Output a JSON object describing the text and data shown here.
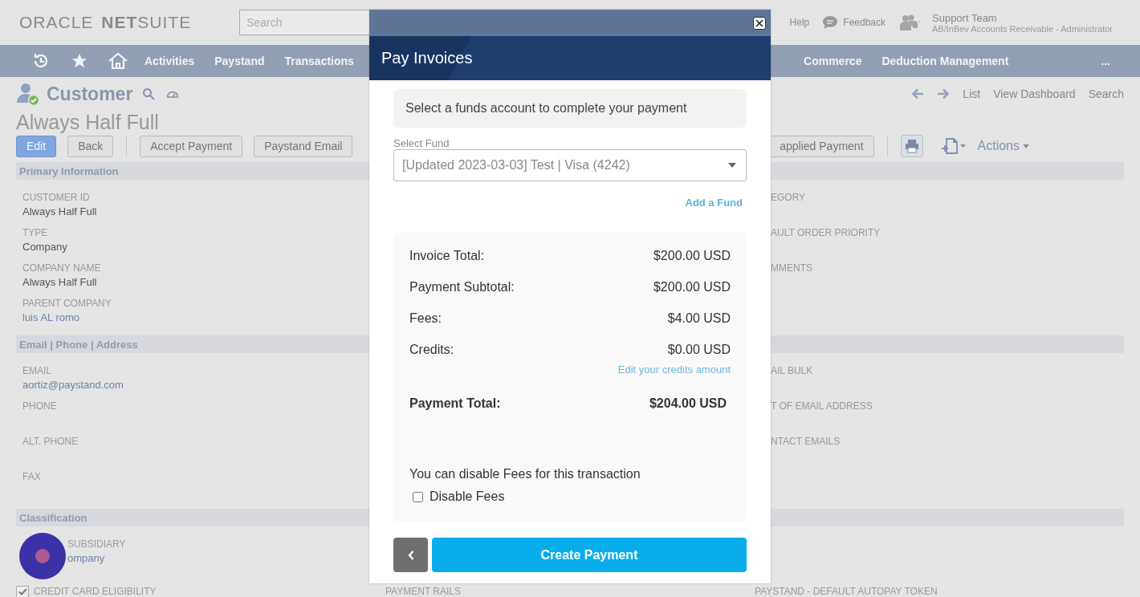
{
  "header": {
    "logo": {
      "brand": "ORACLE",
      "product": "**NET**SUITE"
    },
    "search": {
      "placeholder": "Search"
    },
    "links": [
      "Help",
      "Feedback"
    ],
    "user": {
      "name": "Support Team",
      "role": "AB/InBev Accounts Receivable - Administrator"
    }
  },
  "nav": {
    "items": [
      "Activities",
      "Paystand",
      "Transactions"
    ],
    "right_items": [
      "Commerce",
      "Deduction Management"
    ],
    "overflow": "..."
  },
  "record": {
    "type": "Customer",
    "name": "Always Half Full",
    "nav_links": [
      "List",
      "View Dashboard",
      "Search"
    ],
    "buttons": [
      {
        "label": "Edit",
        "primary": true
      },
      {
        "label": "Back",
        "primary": false
      },
      {
        "label": "Accept Payment",
        "primary": false
      },
      {
        "label": "Paystand Email",
        "primary": false
      }
    ],
    "right_buttons": [
      {
        "label": "applied Payment",
        "primary": false
      }
    ],
    "actions": "Actions"
  },
  "sections": [
    {
      "title": "Primary Information",
      "left": [
        {
          "label": "CUSTOMER ID",
          "value": "Always Half Full",
          "link": false
        },
        {
          "label": "TYPE",
          "value": "Company",
          "link": false
        },
        {
          "label": "COMPANY NAME",
          "value": "Always Half Full",
          "link": false
        },
        {
          "label": "PARENT COMPANY",
          "value": "luis AL romo",
          "link": true
        }
      ],
      "right": [
        "EGORY",
        "AULT ORDER PRIORITY",
        "MMENTS"
      ]
    },
    {
      "title": "Email | Phone | Address",
      "left": [
        {
          "label": "EMAIL",
          "value": "aortiz@paystand.com",
          "link": true
        },
        {
          "label": "PHONE"
        },
        {
          "label": "ALT. PHONE"
        },
        {
          "label": "FAX"
        }
      ],
      "right": [
        "AIL BULK",
        "T OF EMAIL ADDRESS",
        "NTACT EMAILS"
      ]
    },
    {
      "title": "Classification",
      "left": [
        {
          "label": "SUBSIDIARY",
          "value": "ompany",
          "link": true
        }
      ]
    }
  ],
  "footer_fields": [
    {
      "kind": "checkbox",
      "label": "CREDIT CARD ELIGIBILITY",
      "checked": true
    },
    {
      "kind": "label",
      "label": "PAYMENT RAILS"
    },
    {
      "kind": "label",
      "label": "PAYSTAND - DEFAULT AUTOPAY TOKEN"
    }
  ],
  "modal": {
    "title": "Pay Invoices",
    "notice": "Select a funds account to complete your payment",
    "fund_label": "Select Fund",
    "fund_value": "[Updated 2023-03-03] Test | Visa (4242)",
    "add_fund": "Add a Fund",
    "summary": [
      {
        "label": "Invoice Total:",
        "value": "$200.00 USD"
      },
      {
        "label": "Payment Subtotal:",
        "value": "$200.00 USD"
      },
      {
        "label": "Fees:",
        "value": "$4.00 USD"
      },
      {
        "label": "Credits:",
        "value": "$0.00 USD",
        "link": "Edit your credits amount"
      }
    ],
    "total": {
      "label": "Payment Total:",
      "value": "$204.00 USD"
    },
    "fees_note": "You can disable Fees for this transaction",
    "disable_fees": {
      "label": "Disable Fees",
      "checked": false
    },
    "submit": "Create Payment"
  }
}
